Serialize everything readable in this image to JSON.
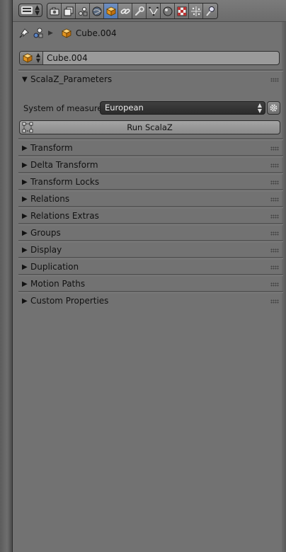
{
  "header": {
    "editor_type_icon": "properties-editor-icon",
    "context_tabs": [
      {
        "name": "render",
        "icon": "camera-icon",
        "active": false
      },
      {
        "name": "render-layers",
        "icon": "layers-icon",
        "active": false
      },
      {
        "name": "scene",
        "icon": "scene-icon",
        "active": false
      },
      {
        "name": "world",
        "icon": "world-icon",
        "active": false
      },
      {
        "name": "object",
        "icon": "cube-icon",
        "active": true
      },
      {
        "name": "constraints",
        "icon": "chain-icon",
        "active": false
      },
      {
        "name": "modifiers",
        "icon": "wrench-icon",
        "active": false
      },
      {
        "name": "data",
        "icon": "mesh-data-icon",
        "active": false
      },
      {
        "name": "material",
        "icon": "material-icon",
        "active": false
      },
      {
        "name": "texture",
        "icon": "texture-icon",
        "active": false
      },
      {
        "name": "particles",
        "icon": "particles-icon",
        "active": false
      },
      {
        "name": "physics",
        "icon": "physics-icon",
        "active": false
      }
    ]
  },
  "breadcrumb": {
    "object_name": "Cube.004"
  },
  "object_field": {
    "value": "Cube.004"
  },
  "scalaz_panel": {
    "title": "ScalaZ_Parameters",
    "system_label": "System of measures::",
    "system_value": "European",
    "run_label": "Run ScalaZ"
  },
  "panels": [
    {
      "label": "Transform"
    },
    {
      "label": "Delta Transform"
    },
    {
      "label": "Transform Locks"
    },
    {
      "label": "Relations"
    },
    {
      "label": "Relations Extras"
    },
    {
      "label": "Groups"
    },
    {
      "label": "Display"
    },
    {
      "label": "Duplication"
    },
    {
      "label": "Motion Paths"
    },
    {
      "label": "Custom Properties"
    }
  ],
  "colors": {
    "background": "#727272",
    "active_tab": "#5680c2",
    "cube_orange": "#f0a030"
  }
}
